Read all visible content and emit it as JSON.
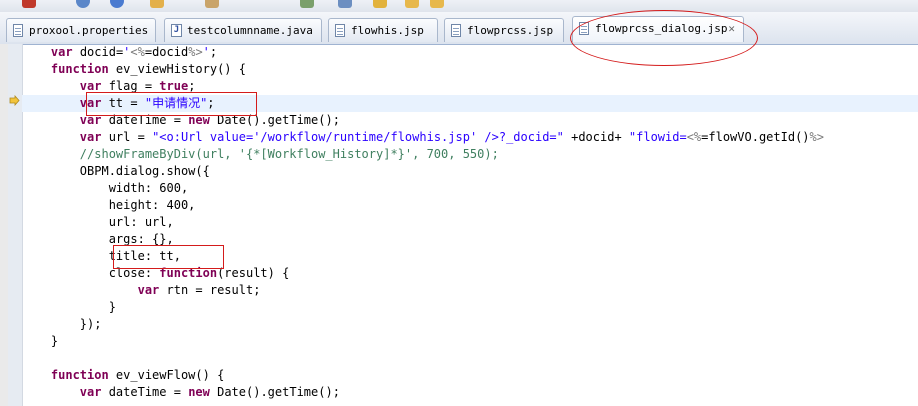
{
  "tabs": [
    {
      "label": "proxool.properties",
      "icon": "properties-file-icon",
      "active": false
    },
    {
      "label": "testcolumnname.java",
      "icon": "java-file-icon",
      "active": false
    },
    {
      "label": "flowhis.jsp",
      "icon": "jsp-file-icon",
      "active": false
    },
    {
      "label": "flowprcss.jsp",
      "icon": "jsp-file-icon",
      "active": false
    },
    {
      "label": "flowprcss_dialog.jsp",
      "icon": "jsp-file-icon",
      "active": true,
      "close": "✕"
    }
  ],
  "colors": {
    "keyword": "#7f0055",
    "string": "#2a00ff",
    "comment": "#3f7f5f",
    "annotation": "#d41b1b"
  },
  "code": {
    "l0": {
      "a": "    ",
      "kw1": "var",
      "b": " docid=",
      "s1": "'",
      "t1": "<%",
      "c": "=docid",
      "t2": "%>",
      "s2": "'",
      "d": ";"
    },
    "l1": {
      "a": "    ",
      "kw1": "function",
      "b": " ev_viewHistory() {"
    },
    "l2": {
      "a": "        ",
      "kw1": "var",
      "b": " flag = ",
      "kw2": "true",
      "c": ";"
    },
    "l3": {
      "a": "        ",
      "kw1": "var",
      "b": " tt = ",
      "s1": "\"申请情况\"",
      "c": ";"
    },
    "l4": {
      "a": "        ",
      "kw1": "var",
      "b": " dateTime = ",
      "kw2": "new",
      "c": " Date().getTime();"
    },
    "l5": {
      "a": "        ",
      "kw1": "var",
      "b": " url = ",
      "s1": "\"<o:Url value='/workflow/runtime/flowhis.jsp' />?_docid=\"",
      "c": " +docid+ ",
      "s2": "\"flowid=",
      "t1": "<%",
      "d": "=flowVO.getId()",
      "t2": "%>"
    },
    "l6": {
      "a": "        ",
      "c1": "//showFrameByDiv(url, '{*[Workflow_History]*}', 700, 550);"
    },
    "l7": {
      "a": "        ",
      "b": "OBPM.dialog.show({"
    },
    "l8": {
      "a": "            ",
      "b": "width: 600,"
    },
    "l9": {
      "a": "            ",
      "b": "height: 400,"
    },
    "l10": {
      "a": "            ",
      "b": "url: url,"
    },
    "l11": {
      "a": "            ",
      "b": "args: {},"
    },
    "l12": {
      "a": "            ",
      "b": "title: tt,"
    },
    "l13": {
      "a": "            ",
      "b": "close: ",
      "kw1": "function",
      "c": "(result) {"
    },
    "l14": {
      "a": "                ",
      "kw1": "var",
      "b": " rtn = result;"
    },
    "l15": {
      "a": "            ",
      "b": "}"
    },
    "l16": {
      "a": "        ",
      "b": "});"
    },
    "l17": {
      "a": "    ",
      "b": "}"
    },
    "l18": {
      "a": ""
    },
    "l19": {
      "a": "    ",
      "kw1": "function",
      "b": " ev_viewFlow() {"
    },
    "l20": {
      "a": "        ",
      "kw1": "var",
      "b": " dateTime = ",
      "kw2": "new",
      "c": " Date().getTime();"
    }
  }
}
